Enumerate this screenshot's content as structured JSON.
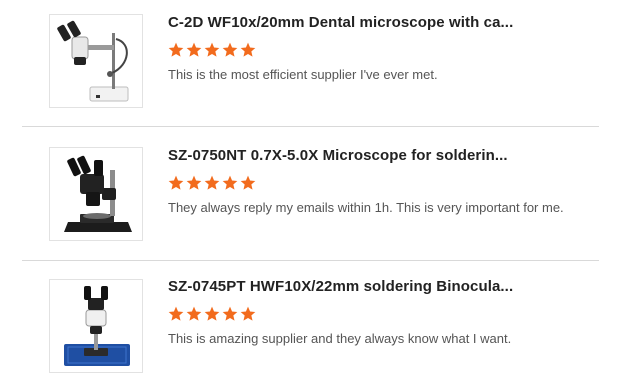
{
  "reviews": [
    {
      "title": "C-2D WF10x/20mm Dental microscope with ca...",
      "rating": 5,
      "comment": "This is the most efficient supplier I've ever met.",
      "image_icon": "stereo-microscope-gooseneck-light"
    },
    {
      "title": "SZ-0750NT 0.7X-5.0X Microscope for solderin...",
      "rating": 5,
      "comment": "They always reply my emails within 1h. This is very important for me.",
      "image_icon": "trinocular-zoom-microscope"
    },
    {
      "title": "SZ-0745PT HWF10X/22mm soldering Binocula...",
      "rating": 5,
      "comment": "This is amazing supplier and they always know what I want.",
      "image_icon": "binocular-zoom-microscope-blue-mat"
    }
  ],
  "colors": {
    "star": "#f26b1d",
    "title": "#222222",
    "comment": "#555555",
    "divider": "#d9d9d9"
  }
}
